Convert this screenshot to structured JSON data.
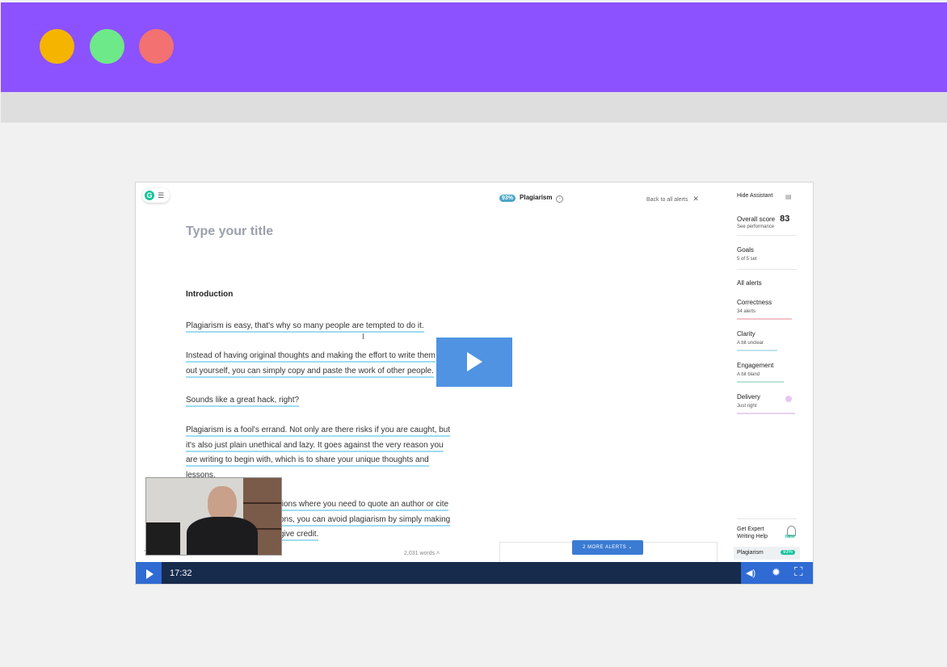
{
  "window": {
    "dots": [
      "#f5b400",
      "#6ee98a",
      "#f37171"
    ],
    "frame_color": "#8c52ff"
  },
  "editor": {
    "doc_title_placeholder": "Type your title",
    "heading": "Introduction",
    "paragraphs": [
      [
        "Plagiarism is easy, that's why so many people are tempted to do it."
      ],
      [
        "Instead of having original thoughts and making the effort to write them",
        "out yourself, you can simply copy and paste the work of other people."
      ],
      [
        "Sounds like a great hack, right?"
      ],
      [
        "Plagiarism is a fool's errand. Not only are there risks if you are caught, but",
        "it's also just plain unethical and lazy. It goes against the very reason you",
        "are writing to begin with, which is to share your unique thoughts and",
        "lessons."
      ],
      [
        "tions where you need to quote an author or cite",
        "ons, you can avoid plagiarism by simply making",
        "give credit."
      ]
    ],
    "word_count": "2,031 words",
    "more_alerts": "2 MORE ALERTS"
  },
  "plagiarism_panel": {
    "score": "93%",
    "title": "Plagiarism",
    "back": "Back to all alerts"
  },
  "sidebar": {
    "hide_assistant": "Hide Assistant",
    "overall_label": "Overall score",
    "overall_score": "83",
    "see_performance": "See performance",
    "goals": "Goals",
    "goals_sub": "5 of 5 set",
    "all_alerts": "All alerts",
    "correctness": "Correctness",
    "correctness_sub": "34 alerts",
    "clarity": "Clarity",
    "clarity_sub": "A bit unclear",
    "engagement": "Engagement",
    "engagement_sub": "A bit bland",
    "delivery": "Delivery",
    "delivery_sub": "Just right",
    "expert_line1": "Get Expert",
    "expert_line2": "Writing Help",
    "new_badge": "NEW",
    "plagiarism": "Plagiarism",
    "plagiarism_pct": "93%"
  },
  "player": {
    "time": "17:32"
  },
  "icons": {
    "play": "play-icon",
    "volume": "volume-icon",
    "settings": "settings-icon",
    "fullscreen": "fullscreen-icon"
  }
}
